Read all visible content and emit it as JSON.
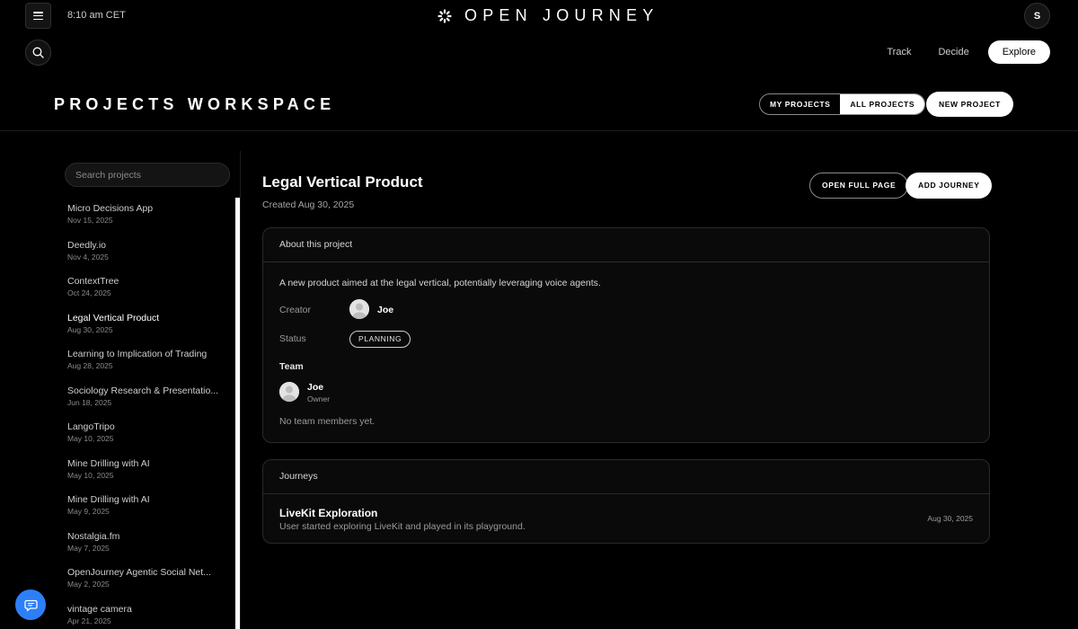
{
  "topbar": {
    "time": "8:10 am CET",
    "brand": "OPEN JOURNEY",
    "user_initial": "S",
    "nav": [
      {
        "label": "Track",
        "active": false
      },
      {
        "label": "Decide",
        "active": false
      },
      {
        "label": "Explore",
        "active": true
      }
    ]
  },
  "workspace": {
    "title": "PROJECTS WORKSPACE",
    "tabs": [
      "MY PROJECTS",
      "ALL PROJECTS"
    ],
    "active_tab": "ALL PROJECTS",
    "new_project_label": "NEW PROJECT"
  },
  "sidebar": {
    "search_placeholder": "Search projects",
    "projects": [
      {
        "name": "Micro Decisions App",
        "date": "Nov 15, 2025"
      },
      {
        "name": "Deedly.io",
        "date": "Nov 4, 2025"
      },
      {
        "name": "ContextTree",
        "date": "Oct 24, 2025"
      },
      {
        "name": "Legal Vertical Product",
        "date": "Aug 30, 2025",
        "active": true
      },
      {
        "name": "Learning to Implication of Trading",
        "date": "Aug 28, 2025"
      },
      {
        "name": "Sociology Research & Presentatio...",
        "date": "Jun 18, 2025"
      },
      {
        "name": "LangoTripo",
        "date": "May 10, 2025"
      },
      {
        "name": "Mine Drilling with AI",
        "date": "May 10, 2025"
      },
      {
        "name": "Mine Drilling with AI",
        "date": "May 9, 2025"
      },
      {
        "name": "Nostalgia.fm",
        "date": "May 7, 2025"
      },
      {
        "name": "OpenJourney Agentic Social Net...",
        "date": "May 2, 2025"
      },
      {
        "name": "vintage camera",
        "date": "Apr 21, 2025"
      }
    ]
  },
  "project": {
    "title": "Legal Vertical Product",
    "created": "Created Aug 30, 2025",
    "open_full_page_label": "OPEN FULL PAGE",
    "add_journey_label": "ADD JOURNEY",
    "about": {
      "heading": "About this project",
      "description": "A new product aimed at the legal vertical, potentially leveraging voice agents.",
      "creator_label": "Creator",
      "creator_name": "Joe",
      "status_label": "Status",
      "status_value": "PLANNING",
      "team_label": "Team",
      "member_name": "Joe",
      "member_role": "Owner",
      "no_team_text": "No team members yet."
    },
    "journeys": {
      "heading": "Journeys",
      "items": [
        {
          "title": "LiveKit Exploration",
          "description": "User started exploring LiveKit and played in its playground.",
          "date": "Aug 30, 2025"
        }
      ]
    }
  },
  "colors": {
    "background": "#000000",
    "accent_blue": "#2d7ff9",
    "card_border": "#2a2a2a"
  }
}
